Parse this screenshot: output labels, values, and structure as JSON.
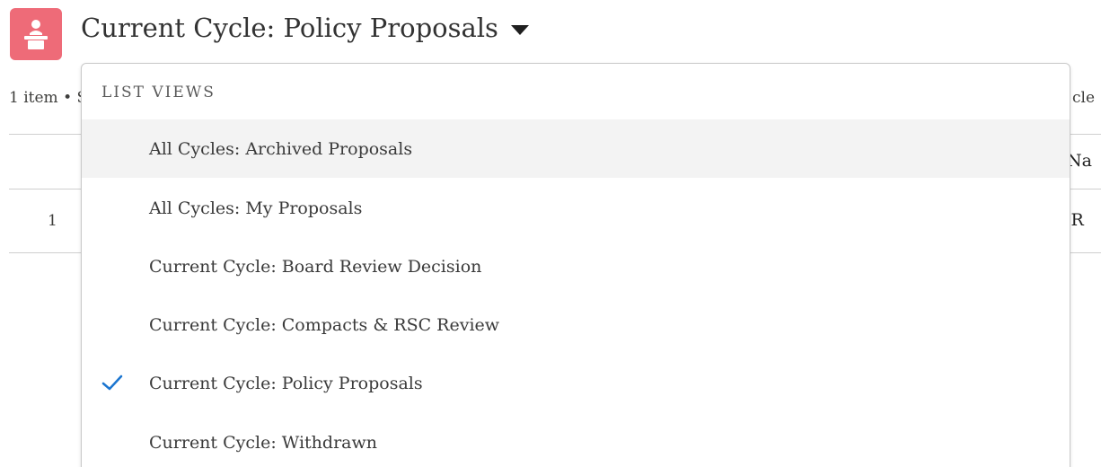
{
  "header": {
    "title": "Current Cycle: Policy Proposals",
    "icon": "podium-icon",
    "icon_color": "#ee6b78"
  },
  "list": {
    "item_count": "1 item • S",
    "header_right_fragment": "cle",
    "column_header_fragment": "Na",
    "rows": [
      {
        "number": "1",
        "cell_fragment": "\\ R"
      }
    ]
  },
  "dropdown": {
    "section_label": "LIST VIEWS",
    "items": [
      {
        "label": "All Cycles: Archived Proposals",
        "selected": false
      },
      {
        "label": "All Cycles: My Proposals",
        "selected": false
      },
      {
        "label": "Current Cycle: Board Review Decision",
        "selected": false
      },
      {
        "label": "Current Cycle: Compacts & RSC Review",
        "selected": false
      },
      {
        "label": "Current Cycle: Policy Proposals",
        "selected": true
      },
      {
        "label": "Current Cycle: Withdrawn",
        "selected": false
      }
    ],
    "check_color": "#1b75d0"
  }
}
